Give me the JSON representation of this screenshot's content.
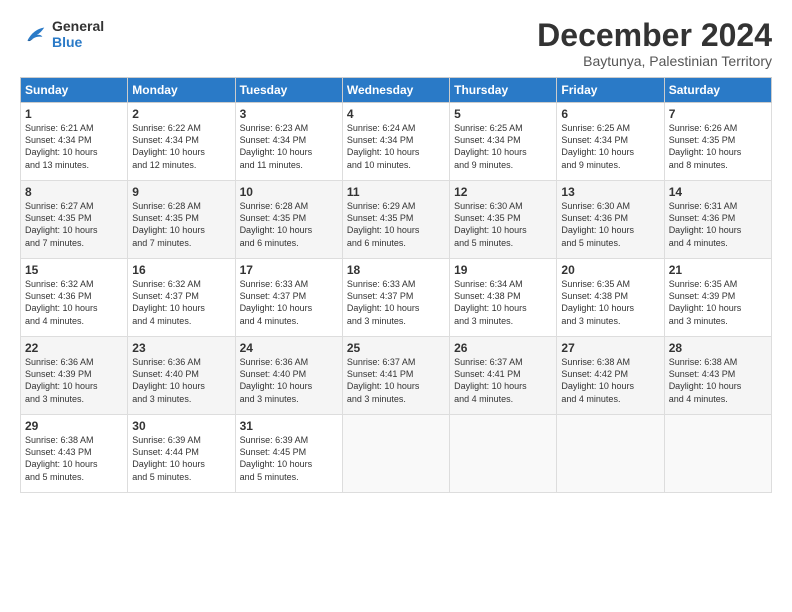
{
  "logo": {
    "line1": "General",
    "line2": "Blue"
  },
  "title": "December 2024",
  "subtitle": "Baytunya, Palestinian Territory",
  "days_header": [
    "Sunday",
    "Monday",
    "Tuesday",
    "Wednesday",
    "Thursday",
    "Friday",
    "Saturday"
  ],
  "weeks": [
    [
      {
        "day": 1,
        "sunrise": "6:21 AM",
        "sunset": "4:34 PM",
        "daylight": "10 hours and 13 minutes."
      },
      {
        "day": 2,
        "sunrise": "6:22 AM",
        "sunset": "4:34 PM",
        "daylight": "10 hours and 12 minutes."
      },
      {
        "day": 3,
        "sunrise": "6:23 AM",
        "sunset": "4:34 PM",
        "daylight": "10 hours and 11 minutes."
      },
      {
        "day": 4,
        "sunrise": "6:24 AM",
        "sunset": "4:34 PM",
        "daylight": "10 hours and 10 minutes."
      },
      {
        "day": 5,
        "sunrise": "6:25 AM",
        "sunset": "4:34 PM",
        "daylight": "10 hours and 9 minutes."
      },
      {
        "day": 6,
        "sunrise": "6:25 AM",
        "sunset": "4:34 PM",
        "daylight": "10 hours and 9 minutes."
      },
      {
        "day": 7,
        "sunrise": "6:26 AM",
        "sunset": "4:35 PM",
        "daylight": "10 hours and 8 minutes."
      }
    ],
    [
      {
        "day": 8,
        "sunrise": "6:27 AM",
        "sunset": "4:35 PM",
        "daylight": "10 hours and 7 minutes."
      },
      {
        "day": 9,
        "sunrise": "6:28 AM",
        "sunset": "4:35 PM",
        "daylight": "10 hours and 7 minutes."
      },
      {
        "day": 10,
        "sunrise": "6:28 AM",
        "sunset": "4:35 PM",
        "daylight": "10 hours and 6 minutes."
      },
      {
        "day": 11,
        "sunrise": "6:29 AM",
        "sunset": "4:35 PM",
        "daylight": "10 hours and 6 minutes."
      },
      {
        "day": 12,
        "sunrise": "6:30 AM",
        "sunset": "4:35 PM",
        "daylight": "10 hours and 5 minutes."
      },
      {
        "day": 13,
        "sunrise": "6:30 AM",
        "sunset": "4:36 PM",
        "daylight": "10 hours and 5 minutes."
      },
      {
        "day": 14,
        "sunrise": "6:31 AM",
        "sunset": "4:36 PM",
        "daylight": "10 hours and 4 minutes."
      }
    ],
    [
      {
        "day": 15,
        "sunrise": "6:32 AM",
        "sunset": "4:36 PM",
        "daylight": "10 hours and 4 minutes."
      },
      {
        "day": 16,
        "sunrise": "6:32 AM",
        "sunset": "4:37 PM",
        "daylight": "10 hours and 4 minutes."
      },
      {
        "day": 17,
        "sunrise": "6:33 AM",
        "sunset": "4:37 PM",
        "daylight": "10 hours and 4 minutes."
      },
      {
        "day": 18,
        "sunrise": "6:33 AM",
        "sunset": "4:37 PM",
        "daylight": "10 hours and 3 minutes."
      },
      {
        "day": 19,
        "sunrise": "6:34 AM",
        "sunset": "4:38 PM",
        "daylight": "10 hours and 3 minutes."
      },
      {
        "day": 20,
        "sunrise": "6:35 AM",
        "sunset": "4:38 PM",
        "daylight": "10 hours and 3 minutes."
      },
      {
        "day": 21,
        "sunrise": "6:35 AM",
        "sunset": "4:39 PM",
        "daylight": "10 hours and 3 minutes."
      }
    ],
    [
      {
        "day": 22,
        "sunrise": "6:36 AM",
        "sunset": "4:39 PM",
        "daylight": "10 hours and 3 minutes."
      },
      {
        "day": 23,
        "sunrise": "6:36 AM",
        "sunset": "4:40 PM",
        "daylight": "10 hours and 3 minutes."
      },
      {
        "day": 24,
        "sunrise": "6:36 AM",
        "sunset": "4:40 PM",
        "daylight": "10 hours and 3 minutes."
      },
      {
        "day": 25,
        "sunrise": "6:37 AM",
        "sunset": "4:41 PM",
        "daylight": "10 hours and 3 minutes."
      },
      {
        "day": 26,
        "sunrise": "6:37 AM",
        "sunset": "4:41 PM",
        "daylight": "10 hours and 4 minutes."
      },
      {
        "day": 27,
        "sunrise": "6:38 AM",
        "sunset": "4:42 PM",
        "daylight": "10 hours and 4 minutes."
      },
      {
        "day": 28,
        "sunrise": "6:38 AM",
        "sunset": "4:43 PM",
        "daylight": "10 hours and 4 minutes."
      }
    ],
    [
      {
        "day": 29,
        "sunrise": "6:38 AM",
        "sunset": "4:43 PM",
        "daylight": "10 hours and 5 minutes."
      },
      {
        "day": 30,
        "sunrise": "6:39 AM",
        "sunset": "4:44 PM",
        "daylight": "10 hours and 5 minutes."
      },
      {
        "day": 31,
        "sunrise": "6:39 AM",
        "sunset": "4:45 PM",
        "daylight": "10 hours and 5 minutes."
      },
      null,
      null,
      null,
      null
    ]
  ]
}
